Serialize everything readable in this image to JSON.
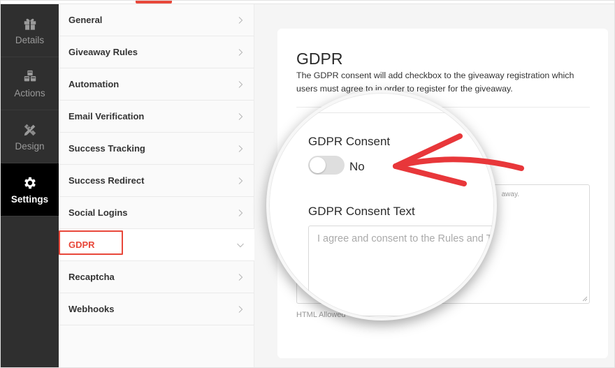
{
  "rail": {
    "items": [
      {
        "label": "Details",
        "icon": "gift-icon"
      },
      {
        "label": "Actions",
        "icon": "cubes-icon"
      },
      {
        "label": "Design",
        "icon": "pencil-ruler-icon"
      },
      {
        "label": "Settings",
        "icon": "gear-icon",
        "active": true
      }
    ]
  },
  "menu": {
    "items": [
      {
        "label": "General"
      },
      {
        "label": "Giveaway Rules"
      },
      {
        "label": "Automation"
      },
      {
        "label": "Email Verification"
      },
      {
        "label": "Success Tracking"
      },
      {
        "label": "Success Redirect"
      },
      {
        "label": "Social Logins"
      },
      {
        "label": "GDPR",
        "active": true
      },
      {
        "label": "Recaptcha"
      },
      {
        "label": "Webhooks"
      }
    ]
  },
  "panel": {
    "title": "GDPR",
    "description": "The GDPR consent will add checkbox to the giveaway registration which users must agree to in order to register for the giveaway.",
    "consent_label": "GDPR Consent",
    "consent_toggle_value": "No",
    "consent_text_label": "GDPR Consent Text",
    "consent_text_placeholder": "I agree and consent to the Rules and Terms of the giveaway.",
    "consent_text_placeholder_visible_right": "away.",
    "help_text": "HTML Allowed"
  },
  "colors": {
    "accent": "#e8473a",
    "rail_bg": "#2f2f2f",
    "rail_active": "#000000"
  }
}
